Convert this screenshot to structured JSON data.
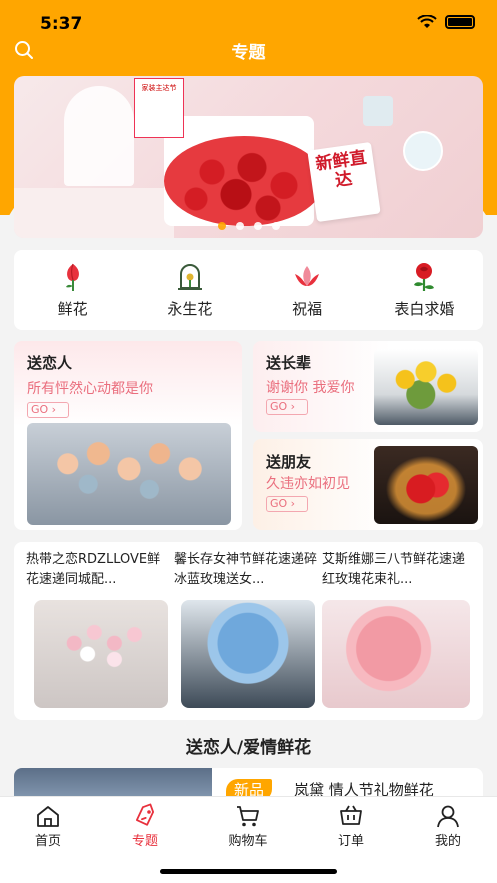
{
  "status_bar": {
    "time": "5:37"
  },
  "nav": {
    "title": "专题"
  },
  "banner": {
    "sign_text": "新鲜直达",
    "tag_text": "家装主达节",
    "slide_count": 4,
    "active_slide": 1
  },
  "categories": [
    {
      "label": "鲜花",
      "icon": "flower-icon"
    },
    {
      "label": "永生花",
      "icon": "preserved-flower-icon"
    },
    {
      "label": "祝福",
      "icon": "lotus-icon"
    },
    {
      "label": "表白求婚",
      "icon": "rose-icon"
    }
  ],
  "occasions": {
    "lover": {
      "title": "送恋人",
      "subtitle": "所有怦然心动都是你",
      "go": "GO"
    },
    "elder": {
      "title": "送长辈",
      "subtitle": "谢谢你 我爱你",
      "go": "GO"
    },
    "friend": {
      "title": "送朋友",
      "subtitle": "久违亦如初见",
      "go": "GO"
    }
  },
  "products": [
    {
      "name": "热带之恋RDZLLOVE鲜花速递同城配..."
    },
    {
      "name": "馨长存女神节鲜花速递碎冰蓝玫瑰送女..."
    },
    {
      "name": "艾斯维娜三八节鲜花速递红玫瑰花束礼..."
    }
  ],
  "section": {
    "title": "送恋人/爱情鲜花"
  },
  "list_item": {
    "badge": "新品",
    "name": "岚黛 情人节礼物鲜花"
  },
  "tabs": [
    {
      "label": "首页",
      "icon": "home-icon",
      "active": false
    },
    {
      "label": "专题",
      "icon": "tag-icon",
      "active": true
    },
    {
      "label": "购物车",
      "icon": "cart-icon",
      "active": false
    },
    {
      "label": "订单",
      "icon": "orders-icon",
      "active": false
    },
    {
      "label": "我的",
      "icon": "user-icon",
      "active": false
    }
  ],
  "colors": {
    "accent": "#ffa600",
    "active_tab": "#e8313d",
    "pink_text": "#ea6f7e"
  }
}
